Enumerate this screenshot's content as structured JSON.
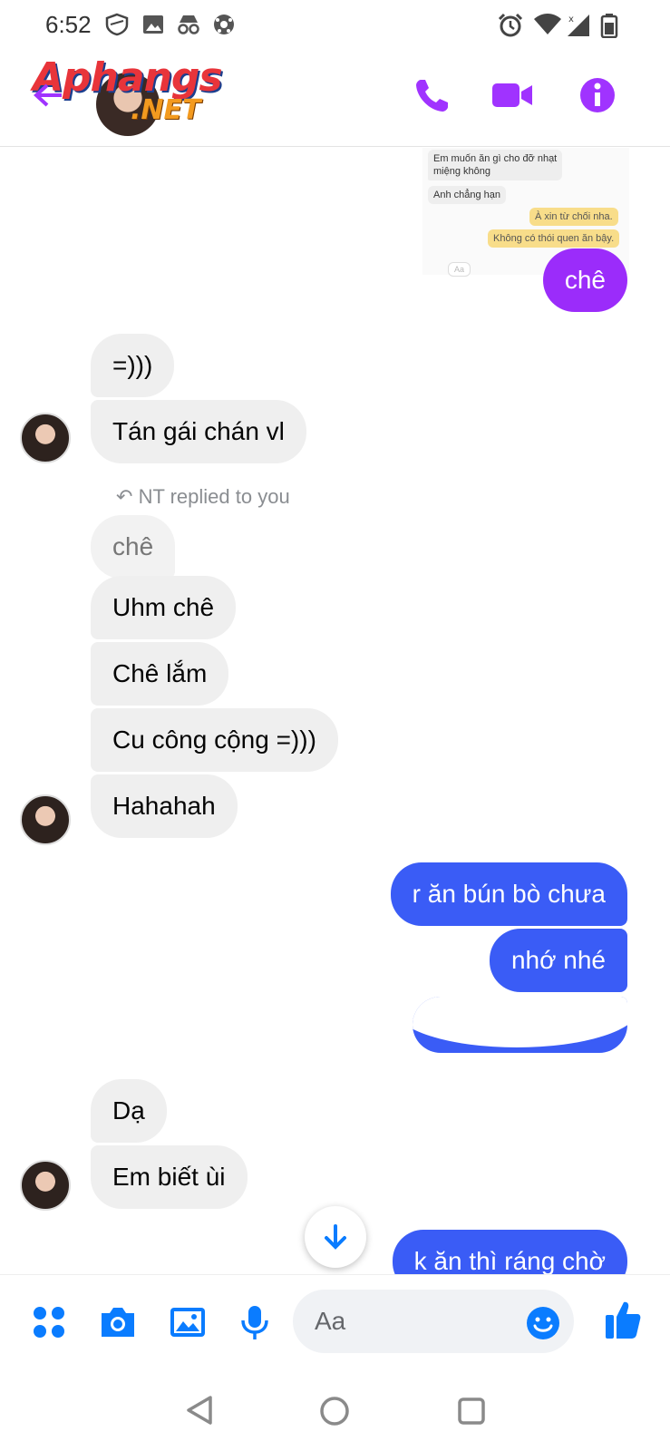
{
  "status_bar": {
    "time": "6:52"
  },
  "header": {
    "logo_main": "Aphangs",
    "logo_sub": ".NET",
    "colors": {
      "accent": "#a033ff"
    }
  },
  "embedded_screenshot": {
    "messages": [
      "Em muốn ăn gì cho đỡ nhạt",
      "miệng không",
      "Anh chẳng hạn",
      "À xin từ chối nha.",
      "Không có thói quen ăn bậy.",
      "Aa"
    ]
  },
  "messages": {
    "m1": "chê",
    "m2": "=)))",
    "m3": "Tán gái chán vl",
    "reply_label": "NT replied to you",
    "quoted": "chê",
    "m4": "Uhm chê",
    "m5": "Chê lắm",
    "m6": "Cu công cộng =)))",
    "m7": "Hahahah",
    "m8": "r ăn bún bò chưa",
    "m9": "nhớ nhé",
    "m10": "Dạ",
    "m11": "Em biết ùi",
    "m12": "k ăn thì ráng chờ"
  },
  "composer": {
    "placeholder": "Aa"
  },
  "colors": {
    "outgoing_purple": "#9b2cfa",
    "outgoing_blue": "#3a5cf6",
    "messenger_blue": "#0a7cff"
  }
}
